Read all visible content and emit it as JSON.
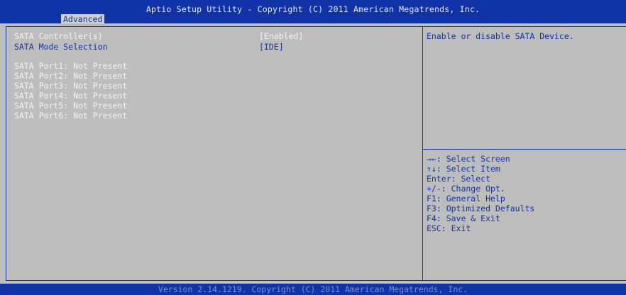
{
  "header": {
    "title": "Aptio Setup Utility - Copyright (C) 2011 American Megatrends, Inc.",
    "tab": "Advanced"
  },
  "settings": [
    {
      "label": "SATA Controller(s)",
      "value": "[Enabled]"
    },
    {
      "label": "SATA Mode Selection",
      "value": "[IDE]"
    }
  ],
  "ports": [
    "SATA Port1: Not Present",
    "SATA Port2: Not Present",
    "SATA Port3: Not Present",
    "SATA Port4: Not Present",
    "SATA Port5: Not Present",
    "SATA Port6: Not Present"
  ],
  "help": {
    "description": "Enable or disable SATA Device."
  },
  "keys": [
    "→←: Select Screen",
    "↑↓: Select Item",
    "Enter: Select",
    "+/-: Change Opt.",
    "F1: General Help",
    "F3: Optimized Defaults",
    "F4: Save & Exit",
    "ESC: Exit"
  ],
  "footer": "Version 2.14.1219. Copyright (C) 2011 American Megatrends, Inc.",
  "colors": {
    "bar": "#1133a8",
    "panel": "#bdbdbd",
    "highlight_text": "#f4f4f4"
  }
}
